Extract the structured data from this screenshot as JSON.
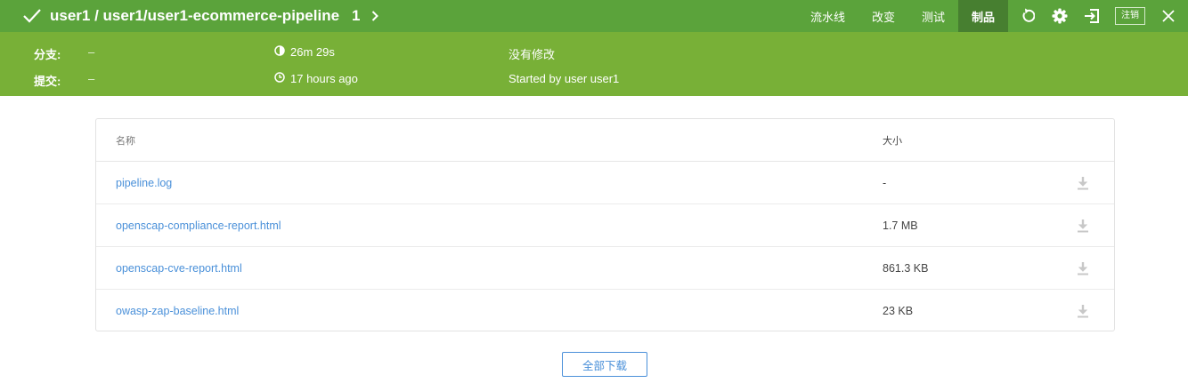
{
  "header": {
    "title": "user1 / user1/user1-ecommerce-pipeline",
    "run_number": "1",
    "status": "success",
    "tabs": [
      {
        "label": "流水线",
        "active": false
      },
      {
        "label": "改变",
        "active": false
      },
      {
        "label": "测试",
        "active": false
      },
      {
        "label": "制品",
        "active": true
      }
    ],
    "logout_label": "注销",
    "icons": [
      "replay-icon",
      "gear-icon",
      "logout-arrow-icon",
      "close-icon"
    ]
  },
  "summary": {
    "branch_label": "分支:",
    "branch_value": "–",
    "commit_label": "提交:",
    "commit_value": "–",
    "duration": "26m 29s",
    "finished": "17 hours ago",
    "changes": "没有修改",
    "cause": "Started by user user1"
  },
  "artifacts": {
    "columns": {
      "name": "名称",
      "size": "大小"
    },
    "rows": [
      {
        "name": "pipeline.log",
        "size": "-"
      },
      {
        "name": "openscap-compliance-report.html",
        "size": "1.7 MB"
      },
      {
        "name": "openscap-cve-report.html",
        "size": "861.3 KB"
      },
      {
        "name": "owasp-zap-baseline.html",
        "size": "23 KB"
      }
    ],
    "download_all_label": "全部下载"
  },
  "colors": {
    "topbar": "#5ba33b",
    "subbar": "#78b037",
    "active_tab": "#477f30",
    "link": "#4a90d9"
  }
}
